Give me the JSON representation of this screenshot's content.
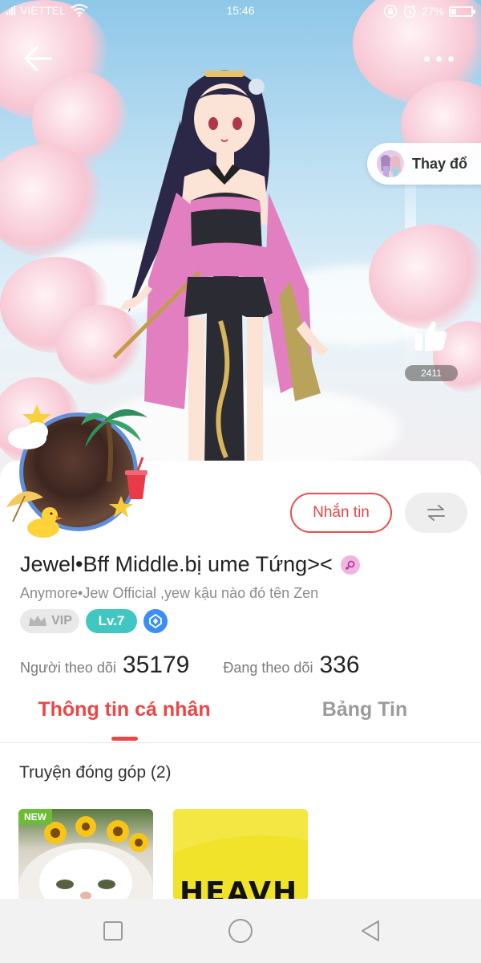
{
  "status_bar": {
    "carrier": "VIETTEL",
    "time": "15:46",
    "battery": "27%",
    "battery_level": 0.27
  },
  "header": {
    "back_icon": "arrow-left-icon",
    "more_icon": "more-dots-icon",
    "change_outfit_label": "Thay đổ",
    "like_count": "2411"
  },
  "profile": {
    "name": "Jewel•Bff Middle.bị ume Tứng><",
    "bio": "Anymore•Jew Official ,yew kậu nào đó tên Zen",
    "vip_label": "VIP",
    "level_label": "Lv.7",
    "message_label": "Nhắn tin",
    "followers_label": "Người theo dõi",
    "followers_value": "35179",
    "following_label": "Đang theo dõi",
    "following_value": "336"
  },
  "tabs": [
    {
      "label": "Thông tin cá nhân",
      "active": true
    },
    {
      "label": "Bảng Tin",
      "active": false
    }
  ],
  "contributions": {
    "title": "Truyện đóng góp (2)",
    "stories": [
      {
        "tag": "NEW"
      },
      {
        "cover_text": "HEAVH"
      }
    ]
  },
  "colors": {
    "accent": "#ee4545",
    "level_badge": "#40c7c1",
    "rank_badge": "#3b8ef2"
  }
}
